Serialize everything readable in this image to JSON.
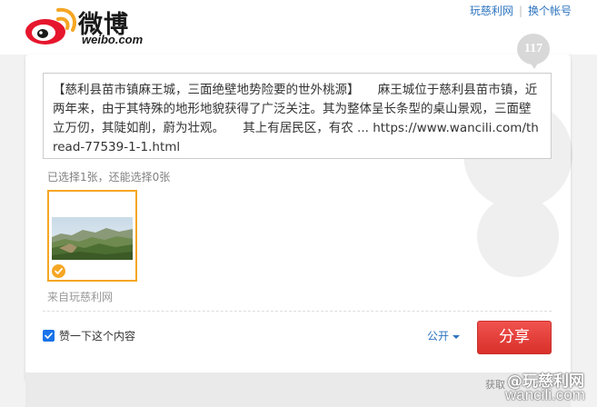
{
  "header": {
    "logo_cn": "微博",
    "logo_en": "weibo.com",
    "links": [
      "玩慈利网",
      "换个帐号"
    ],
    "separator": "|"
  },
  "composer": {
    "remaining_count": "117",
    "text": "【慈利县苗市镇麻王城，三面绝壁地势险要的世外桃源】　　麻王城位于慈利县苗市镇，近两年来，由于其特殊的地形地貌获得了广泛关注。其为整体呈长条型的桌山景观，三面壁立万仞，其陡如削，蔚为壮观。　　其上有居民区，有农 ... https://www.wancili.com/thread-77539-1-1.html",
    "selected_info": "已选择1张，还能选择0张",
    "source_label": "来自玩慈利网"
  },
  "footer": {
    "like_label": "赞一下这个内容",
    "like_checked": true,
    "visibility": "公开",
    "share_label": "分享"
  },
  "overlay": {
    "get_text": "获取",
    "watermark_line1": "@玩慈利网",
    "watermark_line2": "wancili.com"
  },
  "colors": {
    "accent_red": "#e0403c",
    "link_blue": "#2d74c0",
    "selection_orange": "#f5a623"
  }
}
